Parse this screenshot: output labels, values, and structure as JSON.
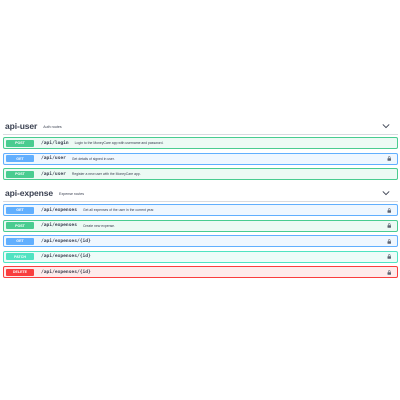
{
  "colors": {
    "post": "#49cc90",
    "get": "#61affe",
    "patch": "#50e3c2",
    "delete": "#f93e3e",
    "text": "#3b4151"
  },
  "sections": [
    {
      "name": "api-user",
      "description": "Auth routes",
      "expanded_icon": "chevron-down-icon",
      "operations": [
        {
          "method": "POST",
          "path": "/api/login",
          "summary": "Login to the MoneyCare app with username and password.",
          "locked": false
        },
        {
          "method": "GET",
          "path": "/api/user",
          "summary": "Get details of signed in user.",
          "locked": true
        },
        {
          "method": "POST",
          "path": "/api/user",
          "summary": "Register a new user with the MoneyCare app.",
          "locked": false
        }
      ]
    },
    {
      "name": "api-expense",
      "description": "Expense routes",
      "expanded_icon": "chevron-down-icon",
      "operations": [
        {
          "method": "GET",
          "path": "/api/expenses",
          "summary": "Get all expenses of the user in the current year.",
          "locked": true
        },
        {
          "method": "POST",
          "path": "/api/expenses",
          "summary": "Create new expense.",
          "locked": true
        },
        {
          "method": "GET",
          "path": "/api/expenses/{id}",
          "summary": "",
          "locked": true
        },
        {
          "method": "PATCH",
          "path": "/api/expenses/{id}",
          "summary": "",
          "locked": true
        },
        {
          "method": "DELETE",
          "path": "/api/expenses/{id}",
          "summary": "",
          "locked": true
        }
      ]
    }
  ]
}
